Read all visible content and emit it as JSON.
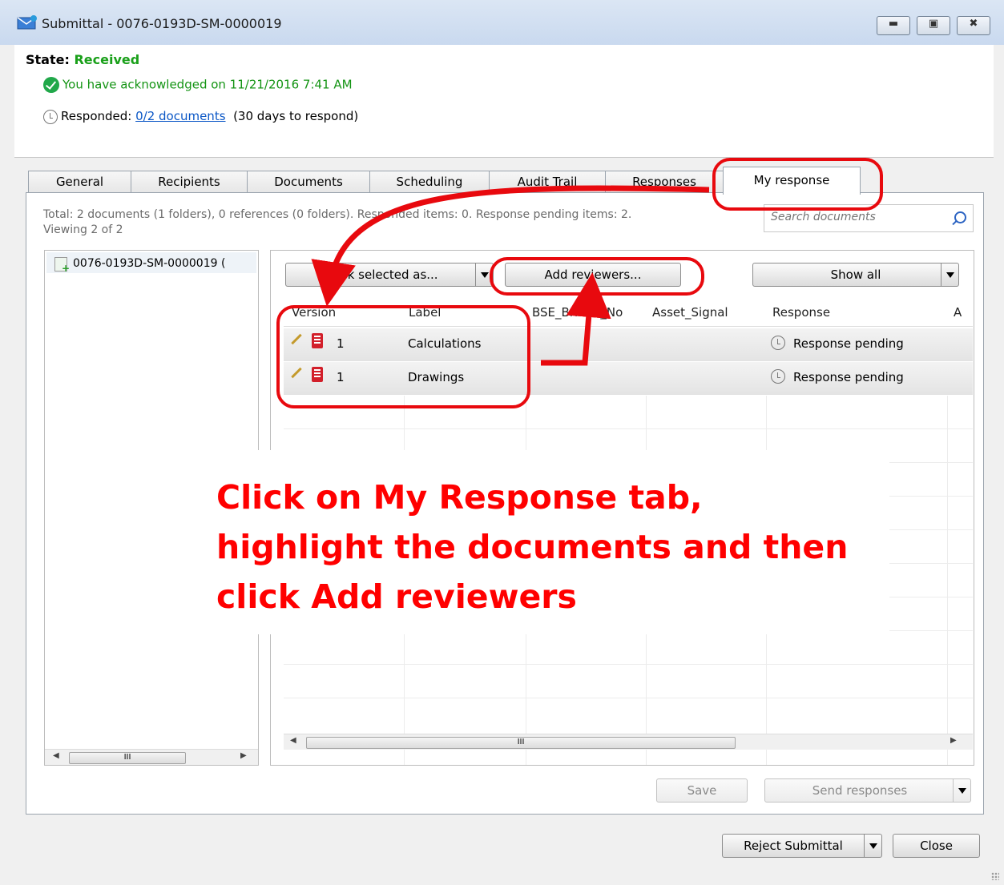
{
  "window": {
    "title": "Submittal - 0076-0193D-SM-0000019",
    "controls": [
      "minimize-icon",
      "maximize-icon",
      "close-icon"
    ]
  },
  "state": {
    "label": "State:",
    "value": "Received",
    "acknowledged": "You have acknowledged on 11/21/2016 7:41 AM",
    "responded_prefix": "Responded:",
    "responded_link": "0/2 documents",
    "responded_suffix": "(30 days to respond)"
  },
  "tabs": [
    "General",
    "Recipients",
    "Documents",
    "Scheduling",
    "Audit Trail",
    "Responses",
    "My response"
  ],
  "summary": {
    "line1": "Total: 2 documents (1 folders), 0 references (0 folders). Responded items: 0. Response pending items: 2.",
    "line2": "Viewing 2 of 2"
  },
  "search": {
    "placeholder": "Search documents"
  },
  "tree": {
    "item": "0076-0193D-SM-0000019 ("
  },
  "toolbar": {
    "mark_selected": "Mark selected as...",
    "add_reviewers": "Add reviewers...",
    "show_all": "Show all"
  },
  "columns": [
    "Version",
    "Label",
    "BSE_Bridge_No",
    "Asset_Signal",
    "Response",
    "A"
  ],
  "rows": [
    {
      "version": "1",
      "label": "Calculations",
      "response": "Response pending"
    },
    {
      "version": "1",
      "label": "Drawings",
      "response": "Response pending"
    }
  ],
  "scroll_text": "III",
  "footer": {
    "save": "Save",
    "send_responses": "Send responses",
    "reject_submittal": "Reject Submittal",
    "close": "Close"
  },
  "annotation": {
    "lines": [
      "Click on My Response tab,",
      "highlight the documents and then",
      "click Add reviewers"
    ],
    "color": "#e8090e"
  }
}
